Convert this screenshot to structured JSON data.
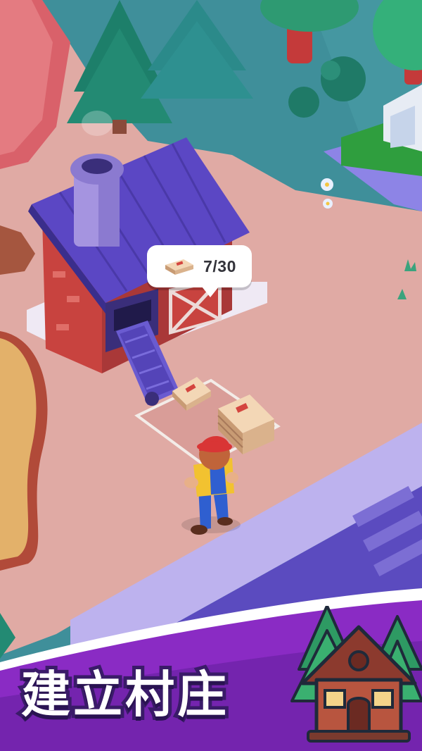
{
  "hud": {
    "resource_icon": "wooden-plank-bundle-icon",
    "resource_counter": "7/30"
  },
  "banner": {
    "title": "建立村庄",
    "icon": "cabin-with-pine-trees-icon"
  },
  "colors": {
    "water": "#3f8f9a",
    "ground": "#e0aaa4",
    "roof": "#5b47c4",
    "brick": "#c8433f",
    "sidewalk": "#bdb2ee",
    "banner_purple": "#8a2bc4",
    "title_stroke": "#3a1b69"
  }
}
